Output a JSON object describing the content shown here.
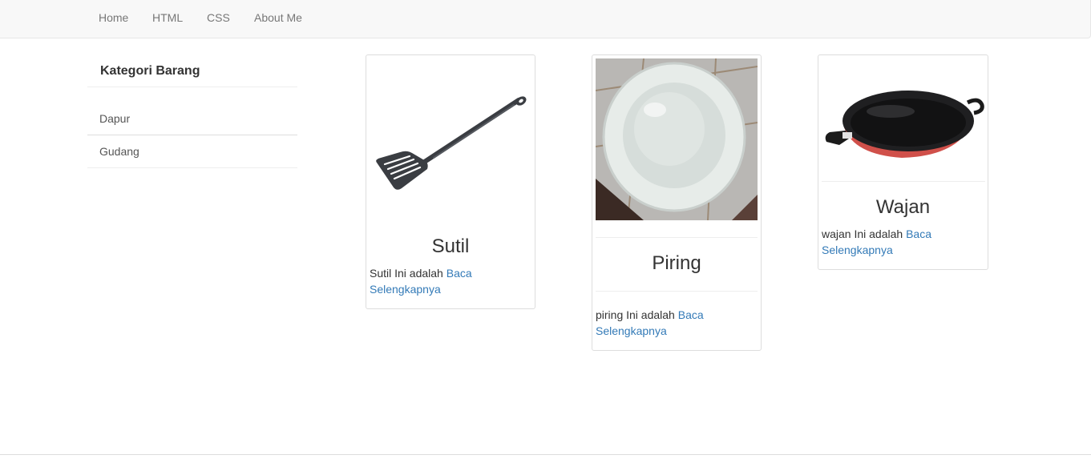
{
  "navbar": {
    "links": [
      "Home",
      "HTML",
      "CSS",
      "About Me"
    ]
  },
  "sidebar": {
    "heading": "Kategori Barang",
    "items": [
      "Dapur",
      "Gudang"
    ]
  },
  "products": [
    {
      "title": "Sutil",
      "desc": "Sutil Ini adalah",
      "link_text": "Baca Selengkapnya",
      "image_icon": "spatula-image"
    },
    {
      "title": "Piring",
      "desc": "piring Ini adalah",
      "link_text": "Baca Selengkapnya",
      "image_icon": "plate-image"
    },
    {
      "title": "Wajan",
      "desc": "wajan Ini adalah",
      "link_text": "Baca Selengkapnya",
      "image_icon": "wok-image"
    }
  ],
  "colors": {
    "link": "#337ab7",
    "navbar_bg": "#f8f8f8",
    "wok_body": "#d0504a"
  }
}
